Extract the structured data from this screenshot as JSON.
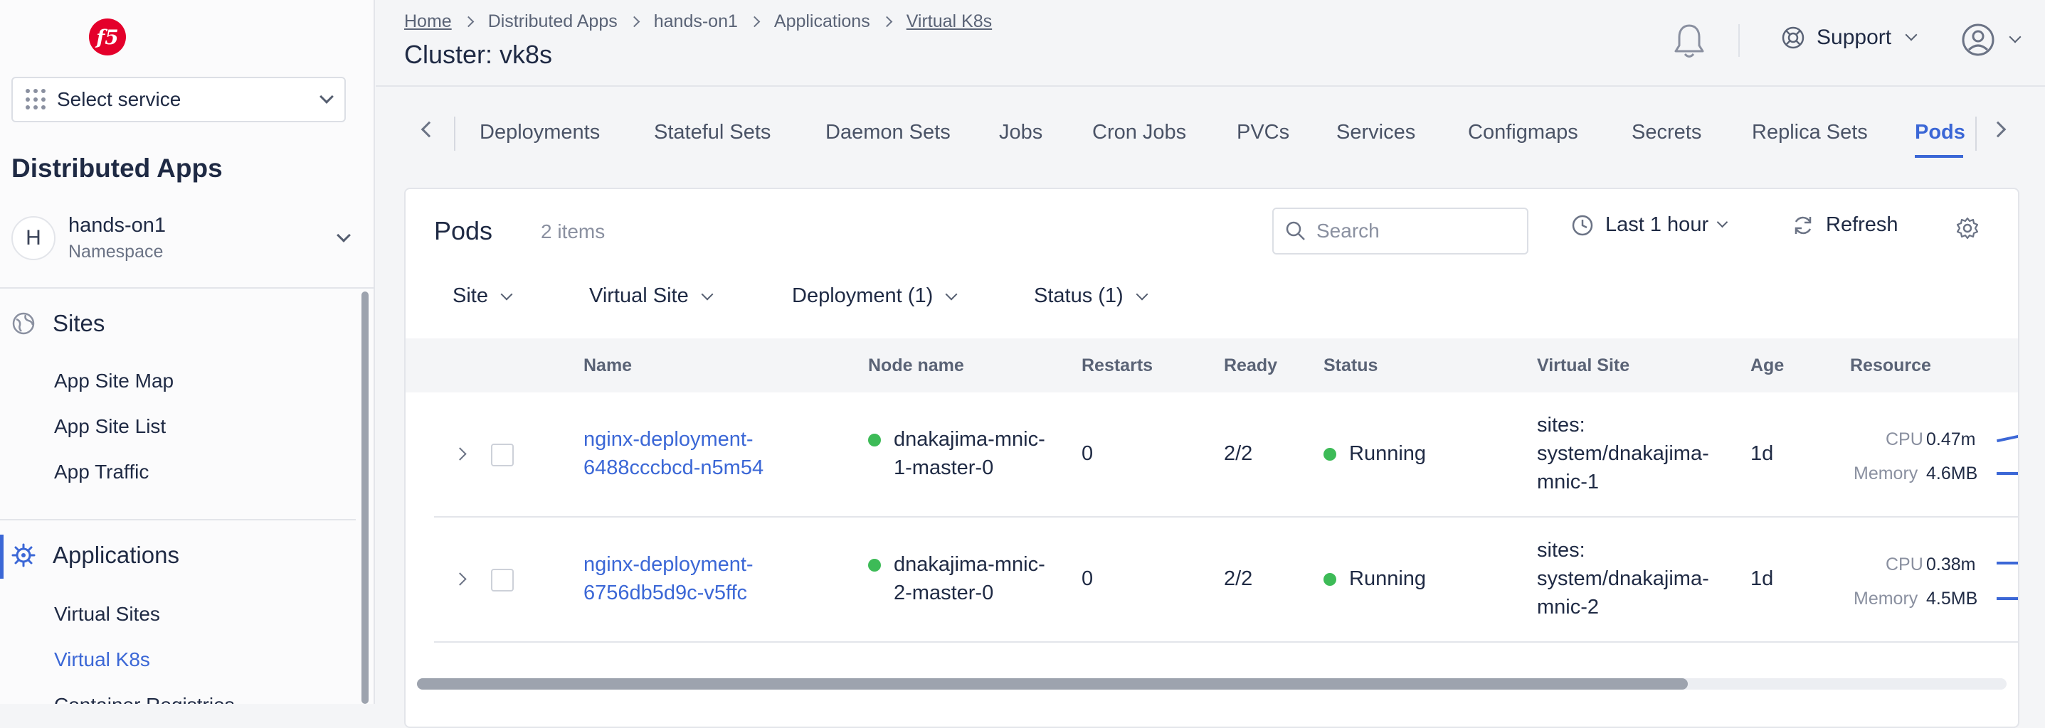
{
  "sidebar": {
    "logo_text": "f5",
    "select_service": "Select service",
    "title": "Distributed Apps",
    "namespace": {
      "avatar": "H",
      "name": "hands-on1",
      "label": "Namespace"
    },
    "sites": {
      "header": "Sites",
      "items": [
        "App Site Map",
        "App Site List",
        "App Traffic"
      ]
    },
    "applications": {
      "header": "Applications",
      "items": [
        "Virtual Sites",
        "Virtual K8s",
        "Container Registries"
      ],
      "active": "Virtual K8s"
    }
  },
  "header": {
    "breadcrumb": [
      "Home",
      "Distributed Apps",
      "hands-on1",
      "Applications",
      "Virtual K8s"
    ],
    "title": "Cluster: vk8s",
    "support": "Support"
  },
  "tabs": {
    "items": [
      "Deployments",
      "Stateful Sets",
      "Daemon Sets",
      "Jobs",
      "Cron Jobs",
      "PVCs",
      "Services",
      "Configmaps",
      "Secrets",
      "Replica Sets",
      "Pods"
    ],
    "active": "Pods"
  },
  "panel": {
    "title": "Pods",
    "count": "2 items",
    "search_placeholder": "Search",
    "time_range": "Last 1 hour",
    "refresh": "Refresh",
    "filters": [
      "Site",
      "Virtual Site",
      "Deployment (1)",
      "Status (1)"
    ]
  },
  "table": {
    "columns": [
      "Name",
      "Node name",
      "Restarts",
      "Ready",
      "Status",
      "Virtual Site",
      "Age",
      "Resource"
    ],
    "rows": [
      {
        "name_line1": "nginx-deployment-",
        "name_line2": "6488cccbcd-n5m54",
        "node_line1": "dnakajima-mnic-",
        "node_line2": "1-master-0",
        "restarts": "0",
        "ready": "2/2",
        "status": "Running",
        "vsite_line1": "sites:",
        "vsite_line2": "system/dnakajima-",
        "vsite_line3": "mnic-1",
        "age": "1d",
        "cpu_label": "CPU",
        "cpu": "0.47m",
        "mem_label": "Memory",
        "memory": "4.6MB"
      },
      {
        "name_line1": "nginx-deployment-",
        "name_line2": "6756db5d9c-v5ffc",
        "node_line1": "dnakajima-mnic-",
        "node_line2": "2-master-0",
        "restarts": "0",
        "ready": "2/2",
        "status": "Running",
        "vsite_line1": "sites:",
        "vsite_line2": "system/dnakajima-",
        "vsite_line3": "mnic-2",
        "age": "1d",
        "cpu_label": "CPU",
        "cpu": "0.38m",
        "mem_label": "Memory",
        "memory": "4.5MB"
      }
    ]
  },
  "colors": {
    "accent": "#3b67d6",
    "status_running": "#3dbb57",
    "brand_logo": "#e4002b"
  },
  "icons": [
    "f5-logo-icon",
    "grid-icon",
    "chevron-down-icon",
    "globe-icon",
    "kubernetes-helm-icon",
    "bell-icon",
    "lifebuoy-icon",
    "user-circle-icon",
    "chevron-left-icon",
    "chevron-right-icon",
    "search-icon",
    "clock-icon",
    "refresh-icon",
    "gear-icon"
  ]
}
